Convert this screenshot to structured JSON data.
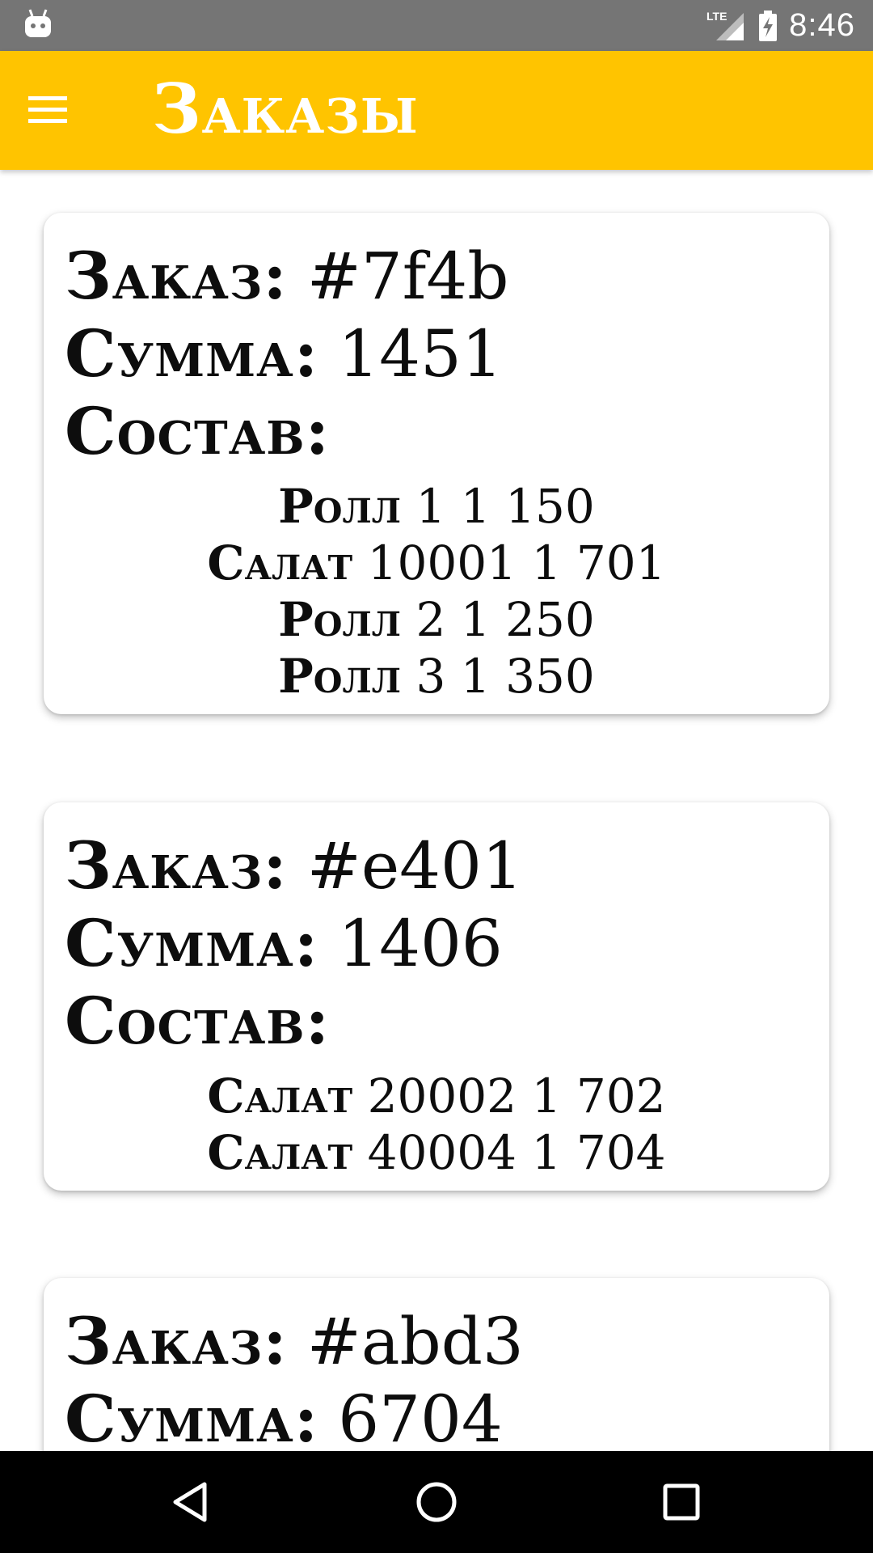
{
  "status_bar": {
    "time": "8:46",
    "network": "LTE",
    "icons": [
      "android-icon",
      "lte-signal-icon",
      "battery-charging-icon"
    ]
  },
  "app_bar": {
    "title": "Заказы",
    "menu_icon": "menu-icon",
    "background": "#FFC400"
  },
  "orders": [
    {
      "order_label": "Заказ:",
      "order_id": "#7f4b",
      "sum_label": "Сумма:",
      "sum": "1451",
      "items_label": "Состав:",
      "items": [
        {
          "name": "Ролл",
          "detail": "1 1 150"
        },
        {
          "name": "Салат",
          "detail": "10001 1 701"
        },
        {
          "name": "Ролл",
          "detail": "2 1 250"
        },
        {
          "name": "Ролл",
          "detail": "3 1 350"
        }
      ]
    },
    {
      "order_label": "Заказ:",
      "order_id": "#e401",
      "sum_label": "Сумма:",
      "sum": "1406",
      "items_label": "Состав:",
      "items": [
        {
          "name": "Салат",
          "detail": "20002 1 702"
        },
        {
          "name": "Салат",
          "detail": "40004 1 704"
        }
      ]
    },
    {
      "order_label": "Заказ:",
      "order_id": "#abd3",
      "sum_label": "Сумма:",
      "sum": "6704"
    }
  ],
  "nav_bar": {
    "icons": [
      "back-icon",
      "home-icon",
      "recents-icon"
    ]
  }
}
